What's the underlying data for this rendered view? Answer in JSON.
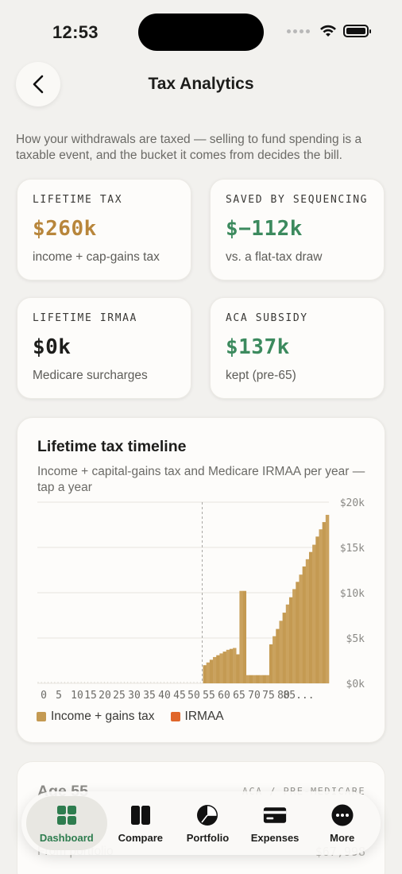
{
  "status": {
    "time": "12:53"
  },
  "header": {
    "title": "Tax Analytics"
  },
  "intro": "How your withdrawals are taxed — selling to fund spending is a taxable event, and the bucket it comes from decides the bill.",
  "stats": [
    {
      "label": "LIFETIME TAX",
      "value": "$260k",
      "sub": "income + cap-gains tax",
      "color": "#b8863b"
    },
    {
      "label": "SAVED BY SEQUENCING",
      "value": "$−112k",
      "sub": "vs. a flat-tax draw",
      "color": "#3c8a5e"
    },
    {
      "label": "LIFETIME IRMAA",
      "value": "$0k",
      "sub": "Medicare surcharges",
      "color": "#1d1d1b"
    },
    {
      "label": "ACA SUBSIDY",
      "value": "$137k",
      "sub": "kept (pre-65)",
      "color": "#3c8a5e"
    }
  ],
  "chart": {
    "title": "Lifetime tax timeline",
    "subtitle": "Income + capital-gains tax and Medicare IRMAA per year — tap a year",
    "legend": {
      "tax": "Income + gains tax",
      "irmaa": "IRMAA"
    },
    "colors": {
      "tax": "#c49a52",
      "irmaa": "#e0662a"
    }
  },
  "chart_data": {
    "type": "bar",
    "stacked": true,
    "x_ticks": [
      "0",
      "5",
      "10",
      "15",
      "20",
      "25",
      "30",
      "35",
      "40",
      "45",
      "50",
      "55",
      "60",
      "65",
      "70",
      "75",
      "80",
      "85..."
    ],
    "y_ticks": [
      "$20k",
      "$15k",
      "$10k",
      "$5k",
      "$0k"
    ],
    "ylim": [
      0,
      20000
    ],
    "grid": true,
    "legend_position": "bottom-left",
    "selected_age": 50,
    "series": [
      {
        "name": "Income + gains tax",
        "x": [
          50,
          51,
          52,
          53,
          54,
          55,
          56,
          57,
          58,
          59,
          60,
          61,
          62,
          63,
          64,
          65,
          66,
          67,
          68,
          69,
          70,
          71,
          72,
          73,
          74,
          75,
          76,
          77,
          78,
          79,
          80,
          81,
          82,
          83,
          84,
          85,
          86,
          87
        ],
        "values": [
          2000,
          2300,
          2600,
          2900,
          3100,
          3300,
          3500,
          3700,
          3800,
          3900,
          3200,
          10200,
          10200,
          900,
          900,
          900,
          900,
          900,
          900,
          900,
          4300,
          5200,
          6000,
          6900,
          7800,
          8700,
          9500,
          10400,
          11200,
          12000,
          12900,
          13700,
          14500,
          15300,
          16200,
          17000,
          17800,
          18600
        ]
      },
      {
        "name": "IRMAA",
        "x": [
          50,
          51,
          52,
          53,
          54,
          55,
          56,
          57,
          58,
          59,
          60,
          61,
          62,
          63,
          64,
          65,
          66,
          67,
          68,
          69,
          70,
          71,
          72,
          73,
          74,
          75,
          76,
          77,
          78,
          79,
          80,
          81,
          82,
          83,
          84,
          85,
          86,
          87
        ],
        "values": [
          0,
          0,
          0,
          0,
          0,
          0,
          0,
          0,
          0,
          0,
          0,
          0,
          0,
          0,
          0,
          0,
          0,
          0,
          0,
          0,
          0,
          0,
          0,
          0,
          0,
          0,
          0,
          0,
          0,
          0,
          0,
          0,
          0,
          0,
          0,
          0,
          0,
          0
        ]
      }
    ]
  },
  "detail": {
    "title": "Age 55",
    "tag": "ACA / PRE-MEDICARE",
    "row_label": "From portfolio",
    "row_value": "$67,998"
  },
  "tabs": [
    {
      "label": "Dashboard",
      "icon": "grid-icon",
      "active": true
    },
    {
      "label": "Compare",
      "icon": "columns-icon",
      "active": false
    },
    {
      "label": "Portfolio",
      "icon": "pie-chart-icon",
      "active": false
    },
    {
      "label": "Expenses",
      "icon": "credit-card-icon",
      "active": false
    },
    {
      "label": "More",
      "icon": "more-icon",
      "active": false
    }
  ]
}
